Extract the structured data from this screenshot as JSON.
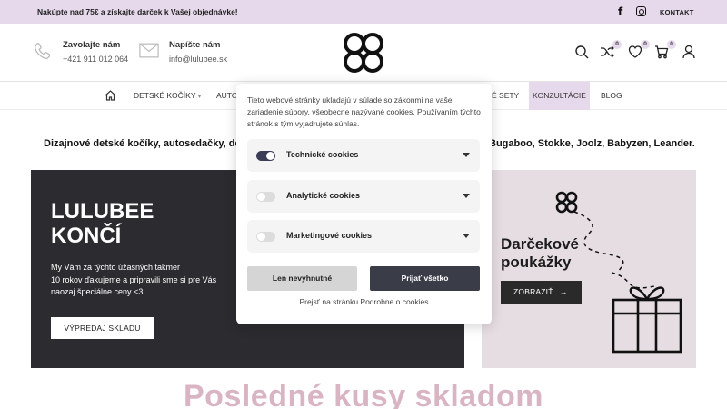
{
  "topbar": {
    "promo": "Nakúpte nad 75€ a získajte darček k Vašej objednávke!",
    "facebook": "f",
    "contact": "KONTAKT"
  },
  "header": {
    "phone_label": "Zavolajte nám",
    "phone_value": "+421 911 012 064",
    "mail_label": "Napíšte nám",
    "mail_value": "info@lulubee.sk",
    "compare_count": "0",
    "wishlist_count": "0",
    "cart_count": "0"
  },
  "nav": {
    "items": [
      {
        "label": "DETSKÉ KOČÍKY",
        "caret": "▾"
      },
      {
        "label": "AUTO"
      },
      {
        "label": "É SETY"
      },
      {
        "label": "KONZULTÁCIE"
      },
      {
        "label": "BLOG"
      }
    ]
  },
  "tagline": {
    "left": "Dizajnové detské kočíky, autosedačky, de",
    "right": "Bugaboo, Stokke, Joolz, Babyzen, Leander."
  },
  "banner_main": {
    "title_line1": "LULUBEE",
    "title_line2": "KONČÍ",
    "text_line1": "My Vám za týchto úžasných takmer",
    "text_line2": "10 rokov ďakujeme a pripravili sme si pre Vás",
    "text_line3": "naozaj špeciálne ceny <3",
    "button": "VÝPREDAJ SKLADU"
  },
  "banner_gift": {
    "title_line1": "Darčekové",
    "title_line2": "poukážky",
    "button": "ZOBRAZIŤ",
    "button_arrow": "→"
  },
  "section": {
    "heading": "Posledné kusy skladom"
  },
  "cookie": {
    "intro": "Tieto webové stránky ukladajú v súlade so zákonmi na vaše zariadenie súbory, všeobecne nazývané cookies. Používaním týchto stránok s tým vyjadrujete súhlas.",
    "categories": [
      {
        "label": "Technické cookies",
        "enabled": true
      },
      {
        "label": "Analytické cookies",
        "enabled": false
      },
      {
        "label": "Marketingové cookies",
        "enabled": false
      }
    ],
    "button_essential": "Len nevyhnutné",
    "button_accept": "Prijať všetko",
    "link": "Prejsť na stránku Podrobne o cookies"
  },
  "colors": {
    "accent_lilac": "#e6d9eb",
    "dark_banner": "#2c2c30",
    "gift_banner": "#e6dde2",
    "heading_pink": "#d9b5c3",
    "accept_button": "#3a3d48"
  }
}
